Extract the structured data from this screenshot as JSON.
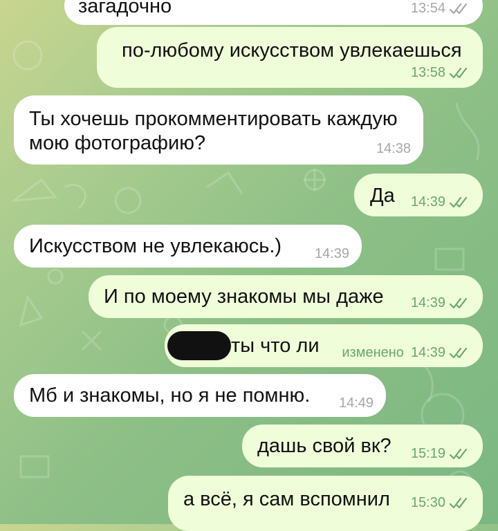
{
  "colors": {
    "incoming_bubble": "#ffffff",
    "outgoing_bubble": "#effed9",
    "outgoing_meta": "#6aa86a",
    "incoming_meta": "#a7a7a7"
  },
  "messages": [
    {
      "direction": "in",
      "text": "загадочно",
      "time": "13:54",
      "read": true,
      "edited": false
    },
    {
      "direction": "out",
      "text": "по-любому искусством увлекаешься",
      "time": "13:58",
      "read": true,
      "edited": false
    },
    {
      "direction": "in",
      "text": "Ты хочешь прокомментировать каждую\nмою фотографию?",
      "time": "14:38",
      "edited": false
    },
    {
      "direction": "out",
      "text": "Да",
      "time": "14:39",
      "read": true,
      "edited": false
    },
    {
      "direction": "in",
      "text": "Искусством не увлекаюсь.)",
      "time": "14:39",
      "edited": false
    },
    {
      "direction": "out",
      "text": "И по моему знакомы мы даже",
      "time": "14:39",
      "read": true,
      "edited": false
    },
    {
      "direction": "out",
      "text": "ты что ли",
      "time": "14:39",
      "read": true,
      "edited": true,
      "edited_label": "изменено",
      "redacted_prefix": true
    },
    {
      "direction": "in",
      "text": "Мб и знакомы, но я не помню.",
      "time": "14:49",
      "edited": false
    },
    {
      "direction": "out",
      "text": "дашь свой вк?",
      "time": "15:19",
      "read": true,
      "edited": false
    },
    {
      "direction": "out",
      "text": "а всё, я сам вспомнил",
      "time": "15:30",
      "read": true,
      "edited": false
    }
  ]
}
